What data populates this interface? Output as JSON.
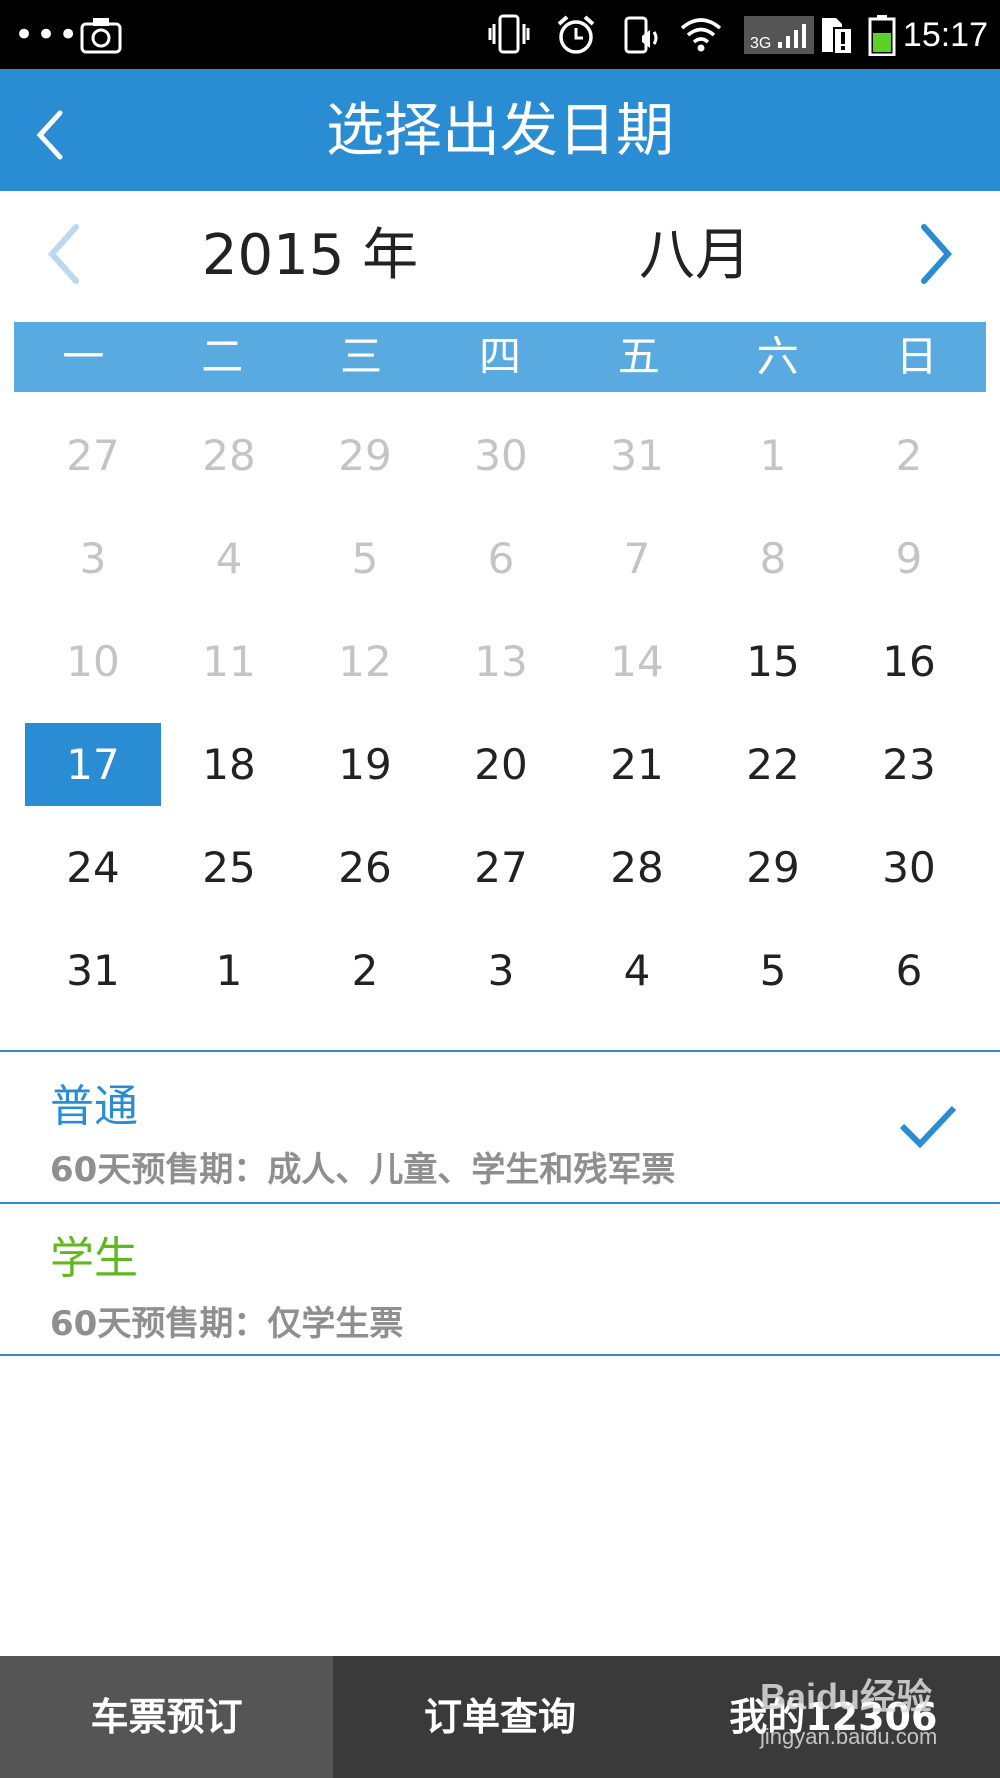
{
  "status_bar": {
    "dots": "•••",
    "icons": [
      "screenshot-icon",
      "vibrate-icon",
      "alarm-icon",
      "call-icon",
      "wifi-icon",
      "signal-3g-icon",
      "sim-icon",
      "battery-icon"
    ],
    "network": "3G",
    "time": "15:17"
  },
  "header": {
    "title": "选择出发日期",
    "back_icon": "chevron-left-icon"
  },
  "month_nav": {
    "year": "2015 年",
    "month": "八月",
    "prev_icon": "chevron-left-icon",
    "next_icon": "chevron-right-icon"
  },
  "weekdays": [
    "一",
    "二",
    "三",
    "四",
    "五",
    "六",
    "日"
  ],
  "calendar": {
    "rows": [
      [
        {
          "d": "27",
          "muted": true
        },
        {
          "d": "28",
          "muted": true
        },
        {
          "d": "29",
          "muted": true
        },
        {
          "d": "30",
          "muted": true
        },
        {
          "d": "31",
          "muted": true
        },
        {
          "d": "1",
          "muted": true
        },
        {
          "d": "2",
          "muted": true
        }
      ],
      [
        {
          "d": "3",
          "muted": true
        },
        {
          "d": "4",
          "muted": true
        },
        {
          "d": "5",
          "muted": true
        },
        {
          "d": "6",
          "muted": true
        },
        {
          "d": "7",
          "muted": true
        },
        {
          "d": "8",
          "muted": true
        },
        {
          "d": "9",
          "muted": true
        }
      ],
      [
        {
          "d": "10",
          "muted": true
        },
        {
          "d": "11",
          "muted": true
        },
        {
          "d": "12",
          "muted": true
        },
        {
          "d": "13",
          "muted": true
        },
        {
          "d": "14",
          "muted": true
        },
        {
          "d": "15",
          "muted": false
        },
        {
          "d": "16",
          "muted": false
        }
      ],
      [
        {
          "d": "17",
          "muted": false,
          "selected": true
        },
        {
          "d": "18",
          "muted": false
        },
        {
          "d": "19",
          "muted": false
        },
        {
          "d": "20",
          "muted": false
        },
        {
          "d": "21",
          "muted": false
        },
        {
          "d": "22",
          "muted": false
        },
        {
          "d": "23",
          "muted": false
        }
      ],
      [
        {
          "d": "24",
          "muted": false
        },
        {
          "d": "25",
          "muted": false
        },
        {
          "d": "26",
          "muted": false
        },
        {
          "d": "27",
          "muted": false
        },
        {
          "d": "28",
          "muted": false
        },
        {
          "d": "29",
          "muted": false
        },
        {
          "d": "30",
          "muted": false
        }
      ],
      [
        {
          "d": "31",
          "muted": false
        },
        {
          "d": "1",
          "muted": false
        },
        {
          "d": "2",
          "muted": false
        },
        {
          "d": "3",
          "muted": false
        },
        {
          "d": "4",
          "muted": false
        },
        {
          "d": "5",
          "muted": false
        },
        {
          "d": "6",
          "muted": false
        }
      ]
    ]
  },
  "ticket_types": [
    {
      "name": "普通",
      "desc": "60天预售期：成人、儿童、学生和残军票",
      "color": "#2a8cd3",
      "selected": true
    },
    {
      "name": "学生",
      "desc": "60天预售期：仅学生票",
      "color": "#5fb91e",
      "selected": false
    }
  ],
  "bottom_nav": {
    "tabs": [
      "车票预订",
      "订单查询",
      "我的12306"
    ],
    "active_index": 0
  },
  "watermark": {
    "line1": "Baidu经验",
    "line2": "jingyan.baidu.com"
  },
  "colors": {
    "accent": "#2a8cd3",
    "weekday_bar": "#5aaae2",
    "student_green": "#5fb91e",
    "muted_text": "#c4c4c4"
  }
}
